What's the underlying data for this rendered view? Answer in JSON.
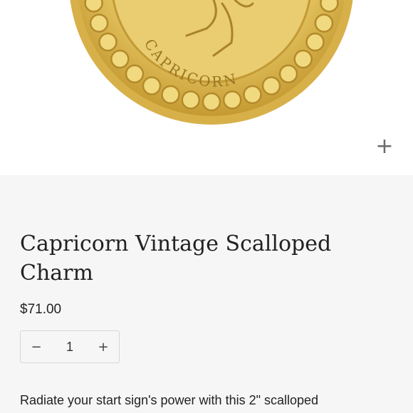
{
  "image": {
    "alt": "Gold scalloped Capricorn charm",
    "medallion_text": "CAPRICORN",
    "colors": {
      "gold": "#e6c45a",
      "gold_dark": "#b8912c",
      "gold_light": "#f6e39a"
    }
  },
  "zoom": {
    "label": "+",
    "icon": "plus-icon"
  },
  "product": {
    "title": "Capricorn Vintage Scalloped Charm",
    "price": "$71.00",
    "quantity": {
      "decrement_label": "−",
      "value": "1",
      "increment_label": "+"
    },
    "description": "Radiate your start sign's power with this 2\" scalloped"
  }
}
